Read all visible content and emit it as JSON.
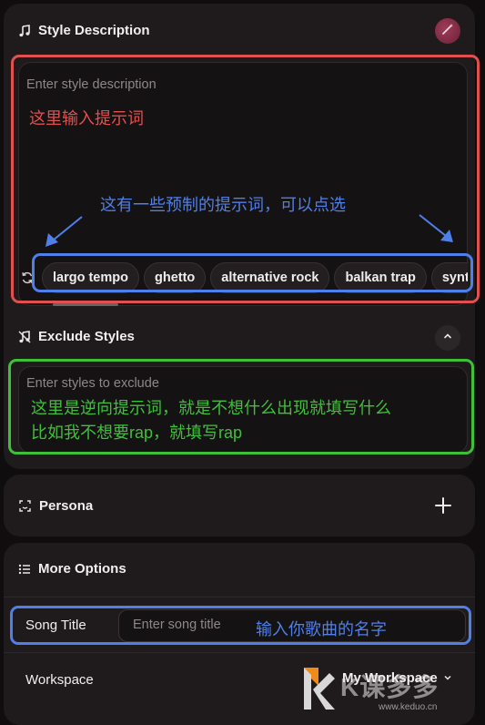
{
  "style_description": {
    "title": "Style Description",
    "placeholder": "Enter style description",
    "chips": [
      "largo tempo",
      "ghetto",
      "alternative rock",
      "balkan trap",
      "synth"
    ]
  },
  "exclude_styles": {
    "title": "Exclude Styles",
    "placeholder": "Enter styles to exclude"
  },
  "persona": {
    "title": "Persona"
  },
  "more_options": {
    "title": "More Options",
    "song_title_label": "Song Title",
    "song_title_placeholder": "Enter song title",
    "workspace_label": "Workspace",
    "workspace_value": "My Workspace"
  },
  "annotations": {
    "style_hint": "这里输入提示词",
    "chips_hint": "这有一些预制的提示词，可以点选",
    "exclude_hint_1": "这里是逆向提示词，就是不想什么出现就填写什么",
    "exclude_hint_2": "比如我不想要rap，就填写rap",
    "song_title_hint": "输入你歌曲的名字",
    "watermark": "K课多多",
    "watermark_url": "www.keduo.cn"
  },
  "colors": {
    "annotation_red": "#e0504f",
    "annotation_blue": "#4f7fe8",
    "annotation_green": "#3fc03a",
    "card_bg": "#1f1b1c",
    "page_bg": "#0f0d0e"
  }
}
